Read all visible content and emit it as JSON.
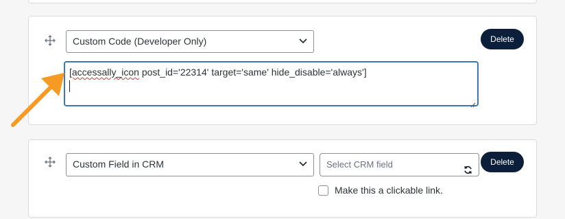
{
  "rows": [
    {
      "type_select": "Custom Code (Developer Only)",
      "delete_label": "Delete",
      "code": {
        "misspelled": "[accessally_icon",
        "rest": " post_id='22314' target='same' hide_disable='always']"
      }
    },
    {
      "type_select": "Custom Field in CRM",
      "crm_field_placeholder": "Select CRM field",
      "delete_label": "Delete",
      "clickable_link_label": "Make this a clickable link.",
      "clickable_link_checked": false
    }
  ],
  "colors": {
    "delete_button": "#0b1f3b",
    "textarea_focus_border": "#3a78b6",
    "annotation_arrow": "#f59a23"
  },
  "icons": {
    "drag": "move-icon",
    "chevron": "chevron-down-icon",
    "refresh": "refresh-icon",
    "annotation": "arrow-annotation"
  }
}
